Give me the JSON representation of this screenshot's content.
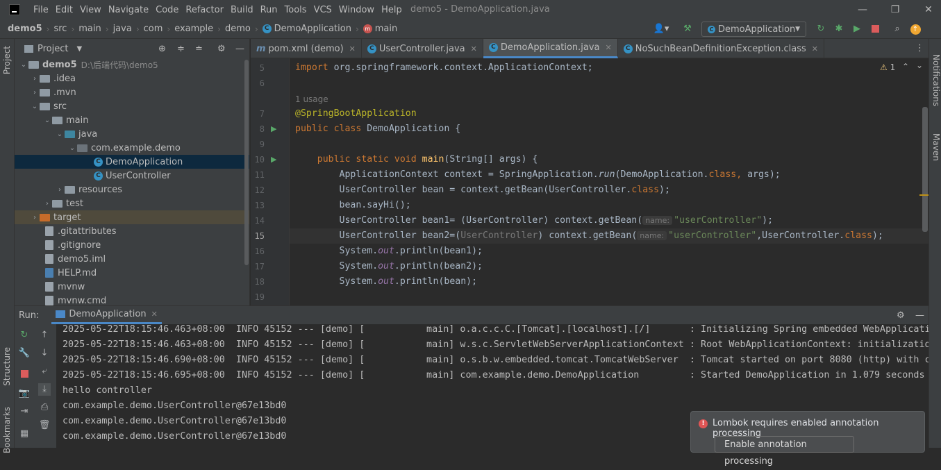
{
  "menubar": {
    "items": [
      "File",
      "Edit",
      "View",
      "Navigate",
      "Code",
      "Refactor",
      "Build",
      "Run",
      "Tools",
      "VCS",
      "Window",
      "Help"
    ],
    "title": "demo5 - DemoApplication.java"
  },
  "breadcrumb": [
    "demo5",
    "src",
    "main",
    "java",
    "com",
    "example",
    "demo",
    "DemoApplication",
    "main"
  ],
  "run_config": "DemoApplication",
  "left_strip": {
    "project": "Project",
    "structure": "Structure",
    "bookmarks": "Bookmarks"
  },
  "right_strip": {
    "notifications": "Notifications",
    "maven": "Maven"
  },
  "project_panel": {
    "title": "Project",
    "root_name": "demo5",
    "root_path": "D:\\后端代码\\demo5",
    "items": [
      ".idea",
      ".mvn",
      "src",
      "main",
      "java",
      "com.example.demo",
      "DemoApplication",
      "UserController",
      "resources",
      "test",
      "target",
      ".gitattributes",
      ".gitignore",
      "demo5.iml",
      "HELP.md",
      "mvnw",
      "mvnw.cmd"
    ]
  },
  "editor_tabs": [
    "pom.xml (demo)",
    "UserController.java",
    "DemoApplication.java",
    "NoSuchBeanDefinitionException.class"
  ],
  "editor": {
    "line_numbers": [
      "5",
      "6",
      "",
      "7",
      "8",
      "9",
      "10",
      "11",
      "12",
      "13",
      "14",
      "15",
      "16",
      "17",
      "18",
      "19"
    ],
    "usages": "1 usage",
    "warning_count": "1",
    "hint_name": "name:",
    "lines": {
      "l5a": "import ",
      "l5b": "org.springframework.context.ApplicationContext;",
      "l7": "@SpringBootApplication",
      "l8a": "public class ",
      "l8b": "DemoApplication {",
      "l10a": "    public static void ",
      "l10b": "main",
      "l10c": "(String[] args) {",
      "l11a": "        ApplicationContext context = SpringApplication.",
      "l11b": "run",
      "l11c": "(DemoApplication.",
      "l11d": "class",
      ", ": ", ",
      "l11e": "args);",
      "l12a": "        UserController bean = context.getBean(UserController.",
      "l12b": "class",
      "l12c": ");",
      "l13": "        bean.sayHi();",
      "l14a": "        UserController bean1= (UserController) context.getBean(",
      "l14b": "\"userController\"",
      "l14c": ");",
      "l15a": "        UserController bean2=(",
      "l15b": "UserController",
      "l15c": ") context.getBean(",
      "l15d": "\"userController\"",
      "l15e": ",UserController.",
      "l15f": "class",
      "l15g": ");",
      "l16a": "        System.",
      "l16b": "out",
      "l16c": ".println(bean1);",
      "l17c": ".println(bean2);",
      "l18c": ".println(bean);"
    }
  },
  "run_panel": {
    "label": "Run:",
    "tab": "DemoApplication",
    "console": [
      "2025-05-22T18:15:46.463+08:00  INFO 45152 --- [demo] [           main] o.a.c.c.C.[Tomcat].[localhost].[/]       : Initializing Spring embedded WebApplicatio",
      "2025-05-22T18:15:46.463+08:00  INFO 45152 --- [demo] [           main] w.s.c.ServletWebServerApplicationContext : Root WebApplicationContext: initialization",
      "2025-05-22T18:15:46.690+08:00  INFO 45152 --- [demo] [           main] o.s.b.w.embedded.tomcat.TomcatWebServer  : Tomcat started on port 8080 (http) with co",
      "2025-05-22T18:15:46.695+08:00  INFO 45152 --- [demo] [           main] com.example.demo.DemoApplication         : Started DemoApplication in 1.079 seconds (",
      "hello controller",
      "com.example.demo.UserController@67e13bd0",
      "com.example.demo.UserController@67e13bd0",
      "com.example.demo.UserController@67e13bd0"
    ]
  },
  "notification": {
    "message": "Lombok requires enabled annotation processing",
    "action": "Enable annotation processing"
  }
}
